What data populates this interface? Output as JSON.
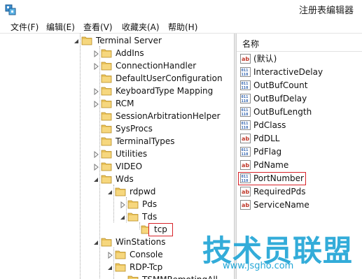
{
  "window": {
    "title": "注册表编辑器"
  },
  "menubar": {
    "items": [
      "文件(F)",
      "编辑(E)",
      "查看(V)",
      "收藏夹(A)",
      "帮助(H)"
    ]
  },
  "tree": {
    "items": [
      {
        "label": "Terminal Server",
        "state": "expanded"
      },
      {
        "label": "AddIns",
        "state": "collapsed"
      },
      {
        "label": "ConnectionHandler",
        "state": "collapsed"
      },
      {
        "label": "DefaultUserConfiguration",
        "state": "none"
      },
      {
        "label": "KeyboardType Mapping",
        "state": "collapsed"
      },
      {
        "label": "RCM",
        "state": "collapsed"
      },
      {
        "label": "SessionArbitrationHelper",
        "state": "none"
      },
      {
        "label": "SysProcs",
        "state": "none"
      },
      {
        "label": "TerminalTypes",
        "state": "none"
      },
      {
        "label": "Utilities",
        "state": "collapsed"
      },
      {
        "label": "VIDEO",
        "state": "collapsed"
      },
      {
        "label": "Wds",
        "state": "expanded"
      },
      {
        "label": "rdpwd",
        "state": "expanded"
      },
      {
        "label": "Pds",
        "state": "collapsed"
      },
      {
        "label": "Tds",
        "state": "expanded"
      },
      {
        "label": "tcp",
        "state": "selected"
      },
      {
        "label": "WinStations",
        "state": "expanded"
      },
      {
        "label": "Console",
        "state": "collapsed"
      },
      {
        "label": "RDP-Tcp",
        "state": "expanded"
      },
      {
        "label": "TSMMRemotingAll",
        "state": "none"
      }
    ]
  },
  "values_pane": {
    "header": "名称",
    "items": [
      {
        "label": "(默认)",
        "type": "ab-icon"
      },
      {
        "label": "InteractiveDelay",
        "type": "binary-icon"
      },
      {
        "label": "OutBufCount",
        "type": "binary-icon"
      },
      {
        "label": "OutBufDelay",
        "type": "binary-icon"
      },
      {
        "label": "OutBufLength",
        "type": "binary-icon"
      },
      {
        "label": "PdClass",
        "type": "binary-icon"
      },
      {
        "label": "PdDLL",
        "type": "ab-icon"
      },
      {
        "label": "PdFlag",
        "type": "binary-icon"
      },
      {
        "label": "PdName",
        "type": "ab-icon"
      },
      {
        "label": "PortNumber",
        "type": "binary-icon",
        "highlighted": true
      },
      {
        "label": "RequiredPds",
        "type": "ab-icon"
      },
      {
        "label": "ServiceName",
        "type": "ab-icon"
      }
    ]
  },
  "watermark": {
    "main": "技术员联盟",
    "sub": "www.jsgho.com"
  },
  "colors": {
    "folder": "#e9c25a",
    "highlight_box": "#d8232a",
    "watermark": "#22a6d6",
    "ab_icon": "#c0392b",
    "binary_icon": "#2b5fad"
  }
}
